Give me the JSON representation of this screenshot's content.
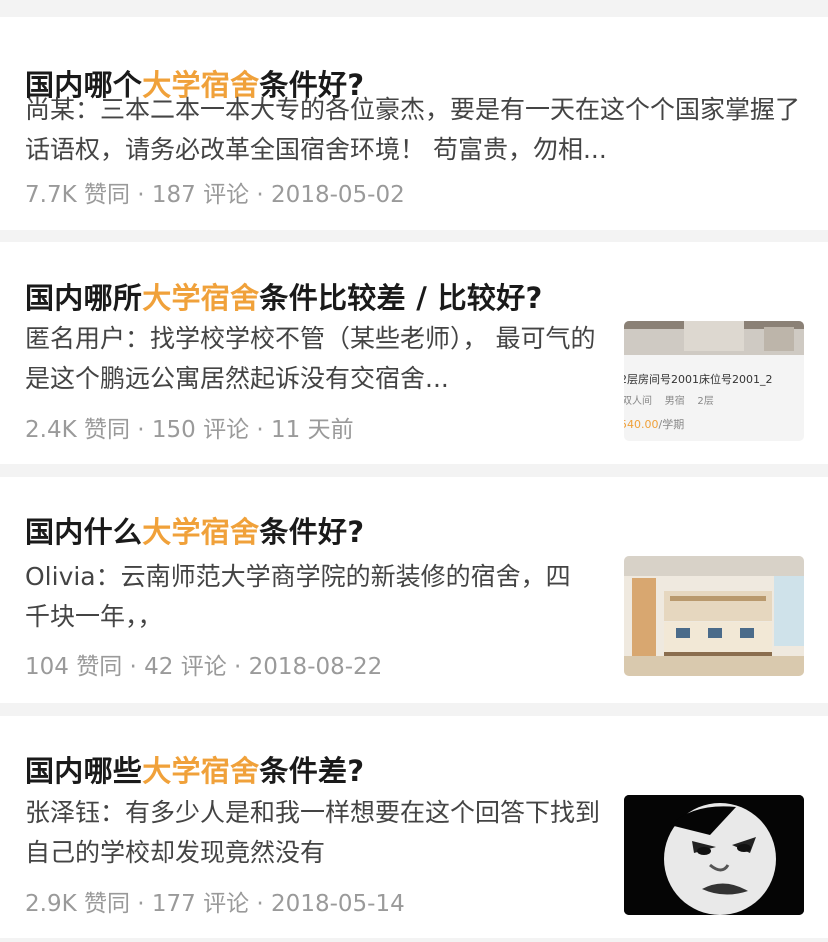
{
  "items": [
    {
      "title_pre": "国内哪个",
      "title_hl": "大学宿舍",
      "title_post": "条件好?",
      "excerpt": "尚某：三本二本一本大专的各位豪杰，要是有一天在这个个国家掌握了话语权，请务必改革全国宿舍环境！ 苟富贵，勿相...",
      "meta": "7.7K 赞同 · 187 评论 · 2018-05-02"
    },
    {
      "title_pre": "国内哪所",
      "title_hl": "大学宿舍",
      "title_post": "条件比较差 / 比较好?",
      "excerpt": "匿名用户：找学校学校不管（某些老师）， 最可气的是这个鹏远公寓居然起诉没有交宿舍...",
      "meta": "2.4K 赞同 · 150 评论 · 11 天前",
      "thumb": {
        "icon": "room-listing-thumbnail",
        "line1": "2层房间号2001床位号2001_2",
        "line2": "双人间    男宿    2层",
        "price": "540.00",
        "price_unit": "/学期"
      }
    },
    {
      "title_pre": "国内什么",
      "title_hl": "大学宿舍",
      "title_post": "条件好?",
      "excerpt": "Olivia：云南师范大学商学院的新装修的宿舍，四千块一年，，",
      "meta": "104 赞同 · 42 评论 · 2018-08-22",
      "thumb": {
        "icon": "dorm-room-photo-thumbnail"
      }
    },
    {
      "title_pre": "国内哪些",
      "title_hl": "大学宿舍",
      "title_post": "条件差?",
      "excerpt": "张泽钰：有多少人是和我一样想要在这个回答下找到自己的学校却发现竟然没有",
      "meta": "2.9K 赞同 · 177 评论 · 2018-05-14",
      "thumb": {
        "icon": "meme-face-thumbnail"
      }
    }
  ],
  "colors": {
    "highlight": "#f0a13a",
    "title": "#1a1a1a",
    "excerpt": "#444444",
    "meta": "#9a9a9a"
  }
}
